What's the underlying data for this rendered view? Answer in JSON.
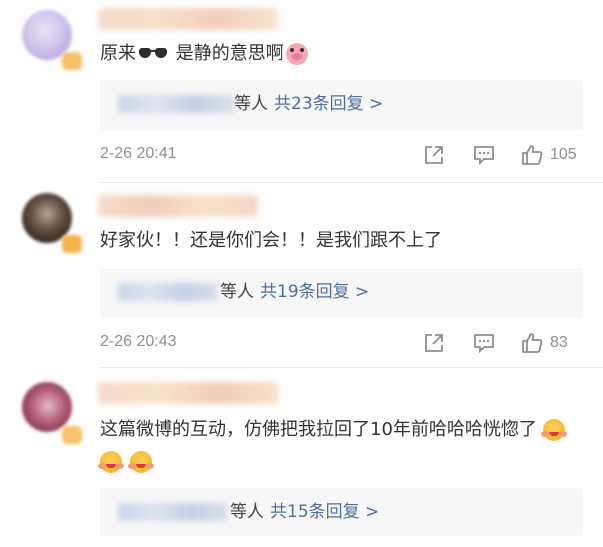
{
  "comments": [
    {
      "text_before": "原来",
      "text_after": " 是静的意思啊",
      "replies_suffix": "等人",
      "replies_link": "共23条回复 >",
      "date": "2-26 20:41",
      "likes": "105"
    },
    {
      "text": "好家伙！！还是你们会！！是我们跟不上了",
      "replies_suffix": "等人",
      "replies_link": "共19条回复 >",
      "date": "2-26 20:43",
      "likes": "83"
    },
    {
      "text": "这篇微博的互动，仿佛把我拉回了10年前哈哈哈恍惚了",
      "replies_suffix": "等人",
      "replies_link": "共15条回复 >"
    }
  ],
  "icons": {
    "share": "share-icon",
    "comment": "comment-icon",
    "like": "thumbs-up-icon",
    "emoji_glasses": "sunglasses-emoji",
    "emoji_pig": "pig-emoji",
    "emoji_hug": "hugging-face-emoji"
  },
  "colors": {
    "link": "#4d6ea0",
    "meta": "#8e8e8e",
    "reply_bg": "#f7f7f7"
  }
}
